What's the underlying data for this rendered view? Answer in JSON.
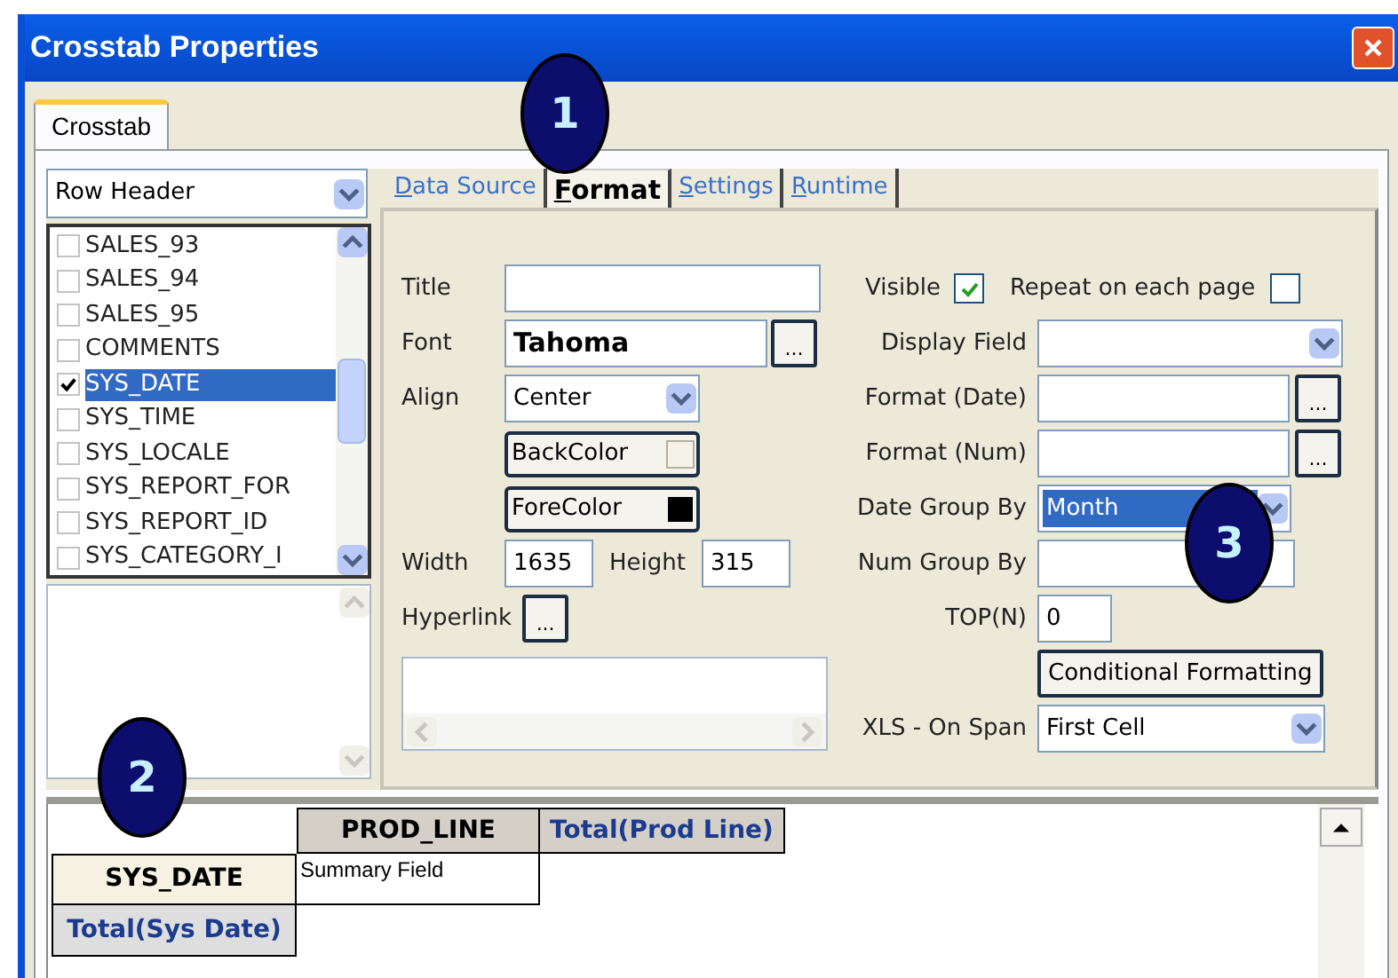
{
  "window": {
    "title": "Crosstab Properties"
  },
  "outer_tabs": [
    {
      "label": "Crosstab",
      "selected": true
    }
  ],
  "header_type": {
    "value": "Row Header"
  },
  "fields": [
    {
      "label": "SALES_93",
      "checked": false,
      "selected": false
    },
    {
      "label": "SALES_94",
      "checked": false,
      "selected": false
    },
    {
      "label": "SALES_95",
      "checked": false,
      "selected": false
    },
    {
      "label": "COMMENTS",
      "checked": false,
      "selected": false
    },
    {
      "label": "SYS_DATE",
      "checked": true,
      "selected": true
    },
    {
      "label": "SYS_TIME",
      "checked": false,
      "selected": false
    },
    {
      "label": "SYS_LOCALE",
      "checked": false,
      "selected": false
    },
    {
      "label": "SYS_REPORT_FOR",
      "checked": false,
      "selected": false
    },
    {
      "label": "SYS_REPORT_ID",
      "checked": false,
      "selected": false
    },
    {
      "label": "SYS_CATEGORY_I",
      "checked": false,
      "selected": false
    }
  ],
  "tabs": [
    {
      "label": "Data Source",
      "selected": false
    },
    {
      "label": "Format",
      "selected": true
    },
    {
      "label": "Settings",
      "selected": false
    },
    {
      "label": "Runtime",
      "selected": false
    }
  ],
  "format": {
    "title": {
      "label": "Title"
    },
    "font": {
      "label": "Font",
      "value": "Tahoma",
      "button": "..."
    },
    "align": {
      "label": "Align",
      "value": "Center"
    },
    "back_color": {
      "label": "BackColor",
      "color": "#f5f2ea"
    },
    "fore_color": {
      "label": "ForeColor",
      "color": "#000000"
    },
    "width": {
      "label": "Width",
      "value": "1635"
    },
    "height": {
      "label": "Height",
      "value": "315"
    },
    "hyperlink": {
      "label": "Hyperlink",
      "button": "..."
    },
    "visible": {
      "label": "Visible",
      "checked": true
    },
    "repeat": {
      "label": "Repeat on each page",
      "checked": false
    },
    "display_field": {
      "label": "Display Field"
    },
    "format_date": {
      "label": "Format (Date)",
      "button": "..."
    },
    "format_num": {
      "label": "Format (Num)",
      "button": "..."
    },
    "date_group_by": {
      "label": "Date Group By",
      "value": "Month"
    },
    "num_group_by": {
      "label": "Num Group By"
    },
    "top_n": {
      "label": "TOP(N)",
      "value": "0"
    },
    "conditional": {
      "label": "Conditional Formatting"
    },
    "xls_on_span": {
      "label": "XLS - On Span",
      "value": "First Cell"
    }
  },
  "crosstab": {
    "column_header": "PROD_LINE",
    "column_total": "Total(Prod Line)",
    "row_header": "SYS_DATE",
    "summary": "Summary Field",
    "row_total": "Total(Sys Date)"
  },
  "callouts": [
    "1",
    "2",
    "3"
  ]
}
